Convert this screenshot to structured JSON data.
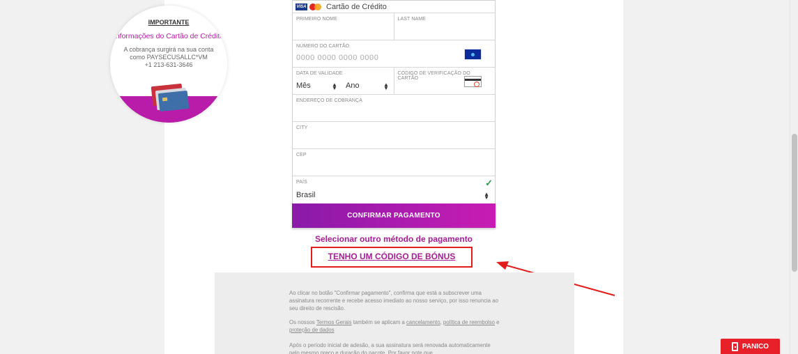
{
  "info": {
    "title": "IMPORTANTE",
    "subtitle": "Informações do Cartão de Crédito",
    "line1": "A cobrança surgirá na sua conta",
    "line2": "como PAYSECUSALLC*VM",
    "phone": "+1 213-631-3646"
  },
  "form": {
    "header_label": "Cartão de Crédito",
    "card_brands": [
      "VISA",
      "Mastercard"
    ],
    "first_name_label": "PRIMEIRO NOME",
    "last_name_label": "LAST NAME",
    "card_number_label": "NÚMERO DO CARTÃO",
    "card_number_placeholder": "0000 0000 0000 0000",
    "expiry_label": "DATA DE VALIDADE",
    "month_value": "Mês",
    "year_value": "Ano",
    "cvv_label": "CÓDIGO DE VERIFICAÇÃO DO CARTÃO",
    "billing_address_label": "ENDEREÇO DE COBRANÇA",
    "city_label": "CITY",
    "zip_label": "CEP",
    "country_label": "PAÍS",
    "country_value": "Brasil"
  },
  "actions": {
    "confirm_label": "CONFIRMAR PAGAMENTO",
    "other_method_label": "Selecionar outro método de pagamento",
    "bonus_code_label": "TENHO UM CÓDIGO DE BÓNUS"
  },
  "terms": {
    "p1": "Ao clicar no botão \"Confirmar pagamento\", confirma que está a subscrever uma assinatura recorrente e recebe acesso imediato ao nosso serviço, por isso renuncia ao seu direito de rescisão.",
    "p2_prefix": "Os nossos ",
    "p2_link1": "Termos Gerais",
    "p2_mid1": " também se aplicam a ",
    "p2_link2": "cancelamento",
    "p2_sep": ", ",
    "p2_link3": "política de reembolso",
    "p2_mid2": " e ",
    "p2_link4": "proteção de dados",
    "p3": "Após o período inicial de adesão, a sua assinatura será renovada automaticamente pelo mesmo preço e duração do pacote. Por favor note que"
  },
  "panic": {
    "label": "PANICO"
  },
  "colors": {
    "accent": "#a81c98",
    "highlight": "#e31b1b",
    "panic": "#e8202a"
  },
  "icons": [
    "visa-icon",
    "mastercard-icon",
    "flag-icon",
    "cvv-card-icon",
    "checkmark-icon",
    "door-exit-icon",
    "credit-cards-illustration"
  ]
}
